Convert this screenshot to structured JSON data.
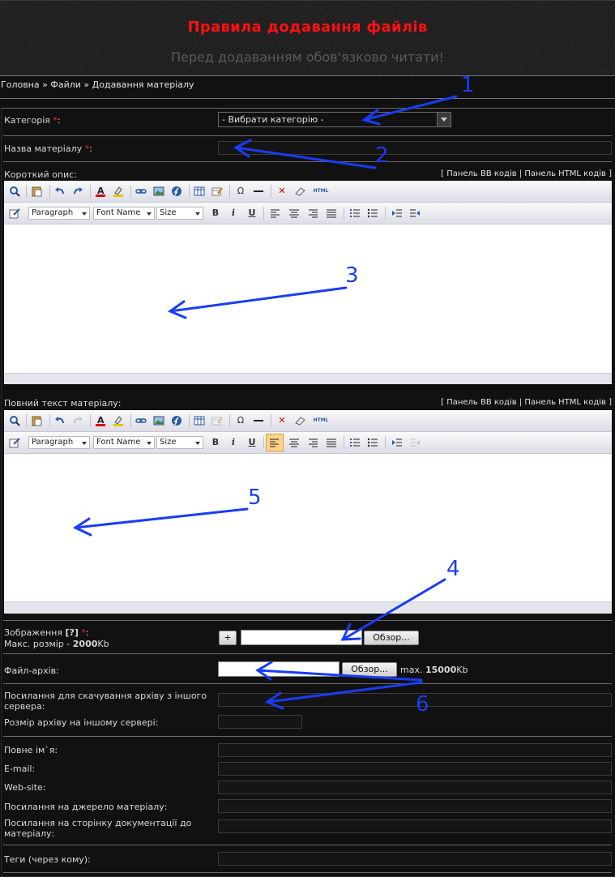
{
  "header": {
    "title": "Правила додавання файлів",
    "subtitle": "Перед додаванням обов'язково читати!"
  },
  "breadcrumb": [
    "Головна",
    "»",
    "Файли",
    "»",
    "Додавання матеріалу"
  ],
  "form": {
    "category": {
      "label": "Категорія",
      "req": "*",
      "colon": ":",
      "selected": "- Вибрати категорію -"
    },
    "title": {
      "label": "Назва матеріалу",
      "req": "*",
      "colon": ":"
    },
    "short": {
      "label": "Короткий опис:"
    },
    "full": {
      "label": "Повний текст матеріалу:"
    },
    "panel_links": "[ Панель BB кодів | Панель HTML кодів ]",
    "editor": {
      "format": "Paragraph",
      "font": "Font Name",
      "size": "Size",
      "bold": "B",
      "italic": "i",
      "underline": "U",
      "omega": "Ω",
      "html": "HTML"
    },
    "image": {
      "label": "Зображення",
      "help": "[?]",
      "req": "*",
      "colon": ":",
      "max_label": "Макс. розмір -",
      "max_value": "2000",
      "max_unit": "Kb",
      "add": "+",
      "browse": "Обзор..."
    },
    "archive": {
      "label": "Файл-архів:",
      "browse": "Обзор...",
      "max_label": "max.",
      "max_value": "15000",
      "max_unit": "Kb"
    },
    "external_link": {
      "label": "Посилання для скачування архіву з іншого сервера:"
    },
    "external_size": {
      "label": "Розмір архіву на іншому сервері:"
    },
    "fullname": {
      "label": "Повне ім`я:"
    },
    "email": {
      "label": "E-mail:"
    },
    "website": {
      "label": "Web-site:"
    },
    "source": {
      "label": "Посилання на джерело матеріалу:"
    },
    "docs": {
      "label": "Посилання на сторінку документації до матеріалу:"
    },
    "tags": {
      "label": "Теги (через кому):"
    }
  },
  "annotations": [
    "1",
    "2",
    "3",
    "4",
    "5",
    "6"
  ],
  "colors": {
    "accent_title": "#ff1010",
    "required": "#ff2020",
    "annotation": "#1a3cf5",
    "toolbar_active": "#ffd38a"
  }
}
